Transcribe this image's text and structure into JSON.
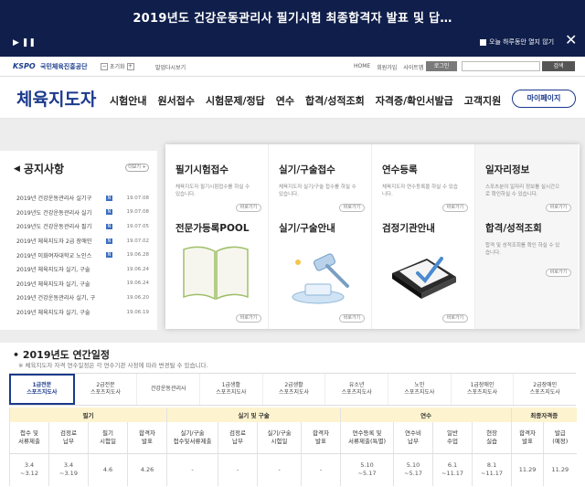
{
  "banner": {
    "title": "2019년도 건강운동관리사 필기시험 최종합격자 발표 및 답…",
    "controls": "▶ ❚❚",
    "dismiss_label": "오늘 하루동안 열지 않기",
    "close": "✕"
  },
  "util": {
    "logo": "KSPO",
    "org": "국민체육진흥공단",
    "font_minus": "−",
    "font_label": "초기화",
    "font_plus": "+",
    "favorite": "발업다시보기",
    "links": [
      "HOME",
      "회원가입",
      "사이트맵"
    ],
    "login": "로그인",
    "search": "검색"
  },
  "nav": {
    "brand": "체육지도자",
    "items": [
      "시험안내",
      "원서접수",
      "시험문제/정답",
      "연수",
      "합격/성적조회",
      "자격증/확인서발급",
      "고객지원"
    ],
    "mypage": "마이페이지"
  },
  "notice": {
    "title": "공지사항",
    "more": "더보기 +",
    "items": [
      {
        "title": "2019년 건강운동관리사 실기구",
        "date": "19.07.08"
      },
      {
        "title": "2019년도 건강운동관리사 실기",
        "date": "19.07.08"
      },
      {
        "title": "2019년도 건강운동관리사 필기",
        "date": "19.07.05"
      },
      {
        "title": "2019년 체육지도자 2급 장애인",
        "date": "19.07.02"
      },
      {
        "title": "2019년 이화여자대학교 노인스",
        "date": "19.06.28"
      },
      {
        "title": "2019년 체육지도자 실기, 구술",
        "date": "19.06.24"
      },
      {
        "title": "2019년 체육지도자 실기, 구술",
        "date": "19.06.24"
      },
      {
        "title": "2019년 건강운동관리사 실기, 구",
        "date": "19.06.20"
      },
      {
        "title": "2019년 체육지도자 실기, 구술",
        "date": "19.06.19"
      }
    ]
  },
  "quick": {
    "written": {
      "title": "필기시험접수",
      "desc": "체육지도자 필기시험접수를 하실 수 있습니다."
    },
    "practical": {
      "title": "실기/구술접수",
      "desc": "체육지도자 실기/구술 접수를 하실 수 있습니다."
    },
    "training": {
      "title": "연수등록",
      "desc": "체육지도자 연수등록을 하실 수 있습니다."
    },
    "jobs": {
      "title": "일자리정보",
      "desc": "스포츠분야 일자리 정보를 실시간으로 확인하실 수 있습니다."
    },
    "pool": {
      "title": "전문가등록POOL"
    },
    "guide": {
      "title": "실기/구술안내"
    },
    "agency": {
      "title": "검정기관안내"
    },
    "results": {
      "title": "합격/성적조회",
      "desc": "합격 및 성적조회를 확인 하실 수 있습니다."
    },
    "go": "바로가기"
  },
  "schedule": {
    "title": "2019년도 연간일정",
    "note": "※ 체육지도자 자격 연수일정은 각 연수기관 사정에 따라 변경될 수 있습니다.",
    "tabs": [
      [
        "1급전문",
        "스포츠지도사"
      ],
      [
        "2급전문",
        "스포츠지도사"
      ],
      [
        "건강운동관리사",
        ""
      ],
      [
        "1급생활",
        "스포츠지도사"
      ],
      [
        "2급생활",
        "스포츠지도사"
      ],
      [
        "유소년",
        "스포츠지도사"
      ],
      [
        "노인",
        "스포츠지도사"
      ],
      [
        "1급장애인",
        "스포츠지도사"
      ],
      [
        "2급장애인",
        "스포츠지도사"
      ]
    ],
    "groups": [
      "필기",
      "실기 및 구술",
      "연수",
      "최종자격증"
    ],
    "subheads": [
      [
        "접수 및",
        "서류제출"
      ],
      [
        "검정료",
        "납부"
      ],
      [
        "필기",
        "시험일"
      ],
      [
        "합격자",
        "발표"
      ],
      [
        "실기/구술",
        "접수및서류제출"
      ],
      [
        "검정료",
        "납부"
      ],
      [
        "실기/구술",
        "시험일"
      ],
      [
        "합격자",
        "발표"
      ],
      [
        "연수등록 및",
        "서류제출(특별)"
      ],
      [
        "연수비",
        "납부"
      ],
      [
        "일반",
        "수업"
      ],
      [
        "현장",
        "실습"
      ],
      [
        "합격자",
        "발표"
      ],
      [
        "발급",
        "(예정)"
      ]
    ],
    "row": [
      [
        "3.4",
        "~3.12"
      ],
      [
        "3.4",
        "~3.19"
      ],
      [
        "4.6",
        ""
      ],
      [
        "4.26",
        ""
      ],
      [
        "-",
        ""
      ],
      [
        "-",
        ""
      ],
      [
        "-",
        ""
      ],
      [
        "-",
        ""
      ],
      [
        "5.10",
        "~5.17"
      ],
      [
        "5.10",
        "~5.17"
      ],
      [
        "6.1",
        "~11.17"
      ],
      [
        "8.1",
        "~11.17"
      ],
      [
        "11.29",
        ""
      ],
      [
        "11.29",
        ""
      ]
    ]
  }
}
